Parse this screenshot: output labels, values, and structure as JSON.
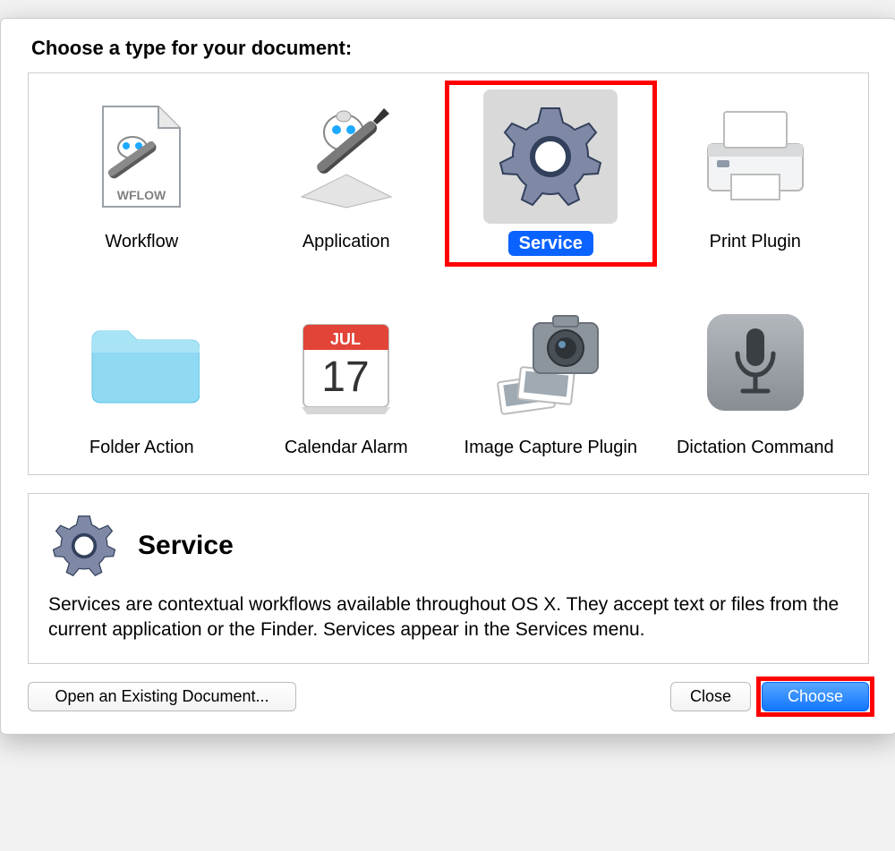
{
  "heading": "Choose a type for your document:",
  "types": [
    {
      "label": "Workflow"
    },
    {
      "label": "Application"
    },
    {
      "label": "Service",
      "selected": true
    },
    {
      "label": "Print Plugin"
    },
    {
      "label": "Folder Action"
    },
    {
      "label": "Calendar Alarm"
    },
    {
      "label": "Image Capture Plugin"
    },
    {
      "label": "Dictation Command"
    }
  ],
  "calendar": {
    "month": "JUL",
    "day": "17"
  },
  "description": {
    "title": "Service",
    "text": "Services are contextual workflows available throughout OS X. They accept text or files from the current application or the Finder. Services appear in the Services menu."
  },
  "buttons": {
    "open": "Open an Existing Document...",
    "close": "Close",
    "choose": "Choose"
  },
  "workflow_ext": "WFLOW"
}
